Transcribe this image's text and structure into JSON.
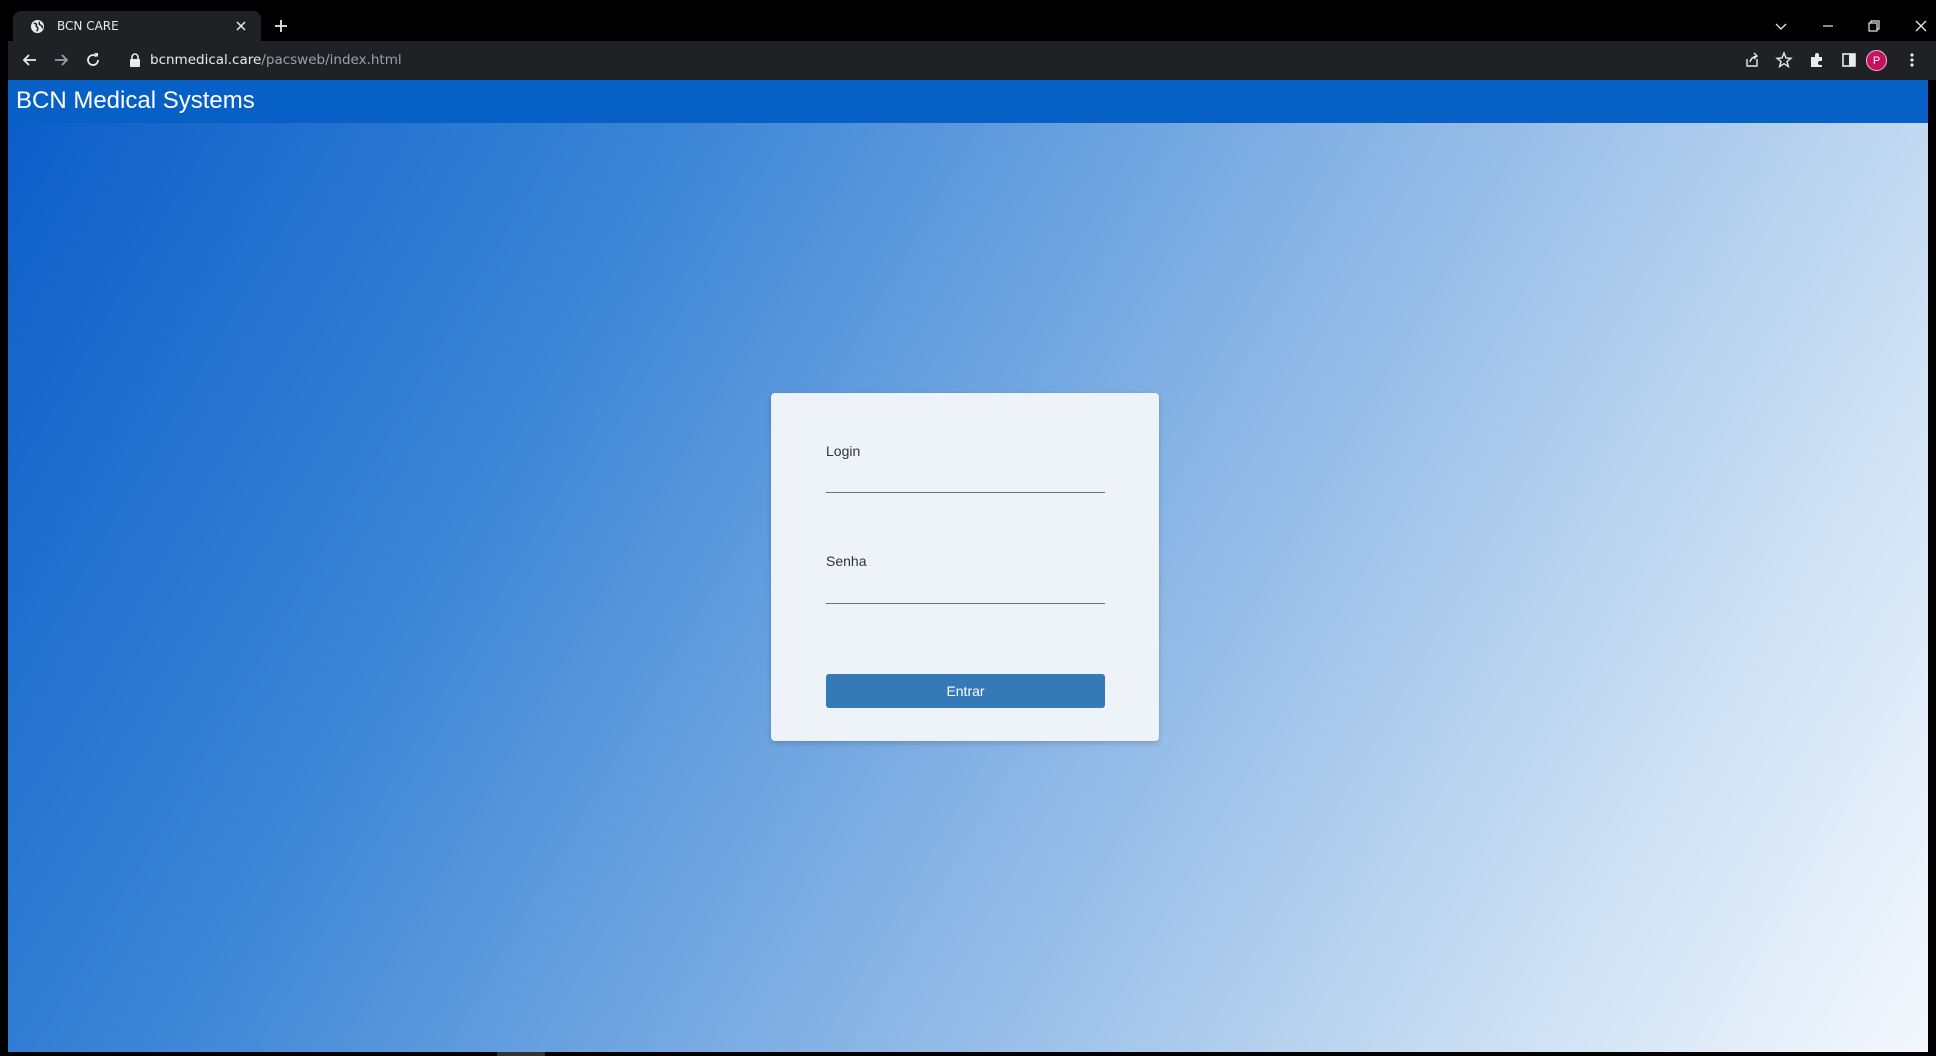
{
  "browser": {
    "tab_title": "BCN CARE",
    "url_host": "bcnmedical.care",
    "url_path": "/pacsweb/index.html",
    "profile_initial": "P"
  },
  "app": {
    "title": "BCN Medical Systems"
  },
  "login_form": {
    "login_label": "Login",
    "login_value": "",
    "password_label": "Senha",
    "password_value": "",
    "submit_label": "Entrar"
  },
  "colors": {
    "header_blue": "#0760c6",
    "button_blue": "#3579b6",
    "card_bg": "#eef3fa",
    "profile_avatar": "#c51162"
  },
  "icons": {
    "tab": [
      "globe-icon",
      "close-icon",
      "plus-icon"
    ],
    "window": [
      "chevron-down-icon",
      "minimize-icon",
      "restore-icon",
      "close-icon"
    ],
    "nav": [
      "back-arrow-icon",
      "forward-arrow-icon",
      "reload-icon",
      "lock-icon"
    ],
    "toolbar": [
      "share-icon",
      "star-icon",
      "puzzle-icon",
      "side-panel-icon",
      "kebab-menu-icon"
    ]
  }
}
